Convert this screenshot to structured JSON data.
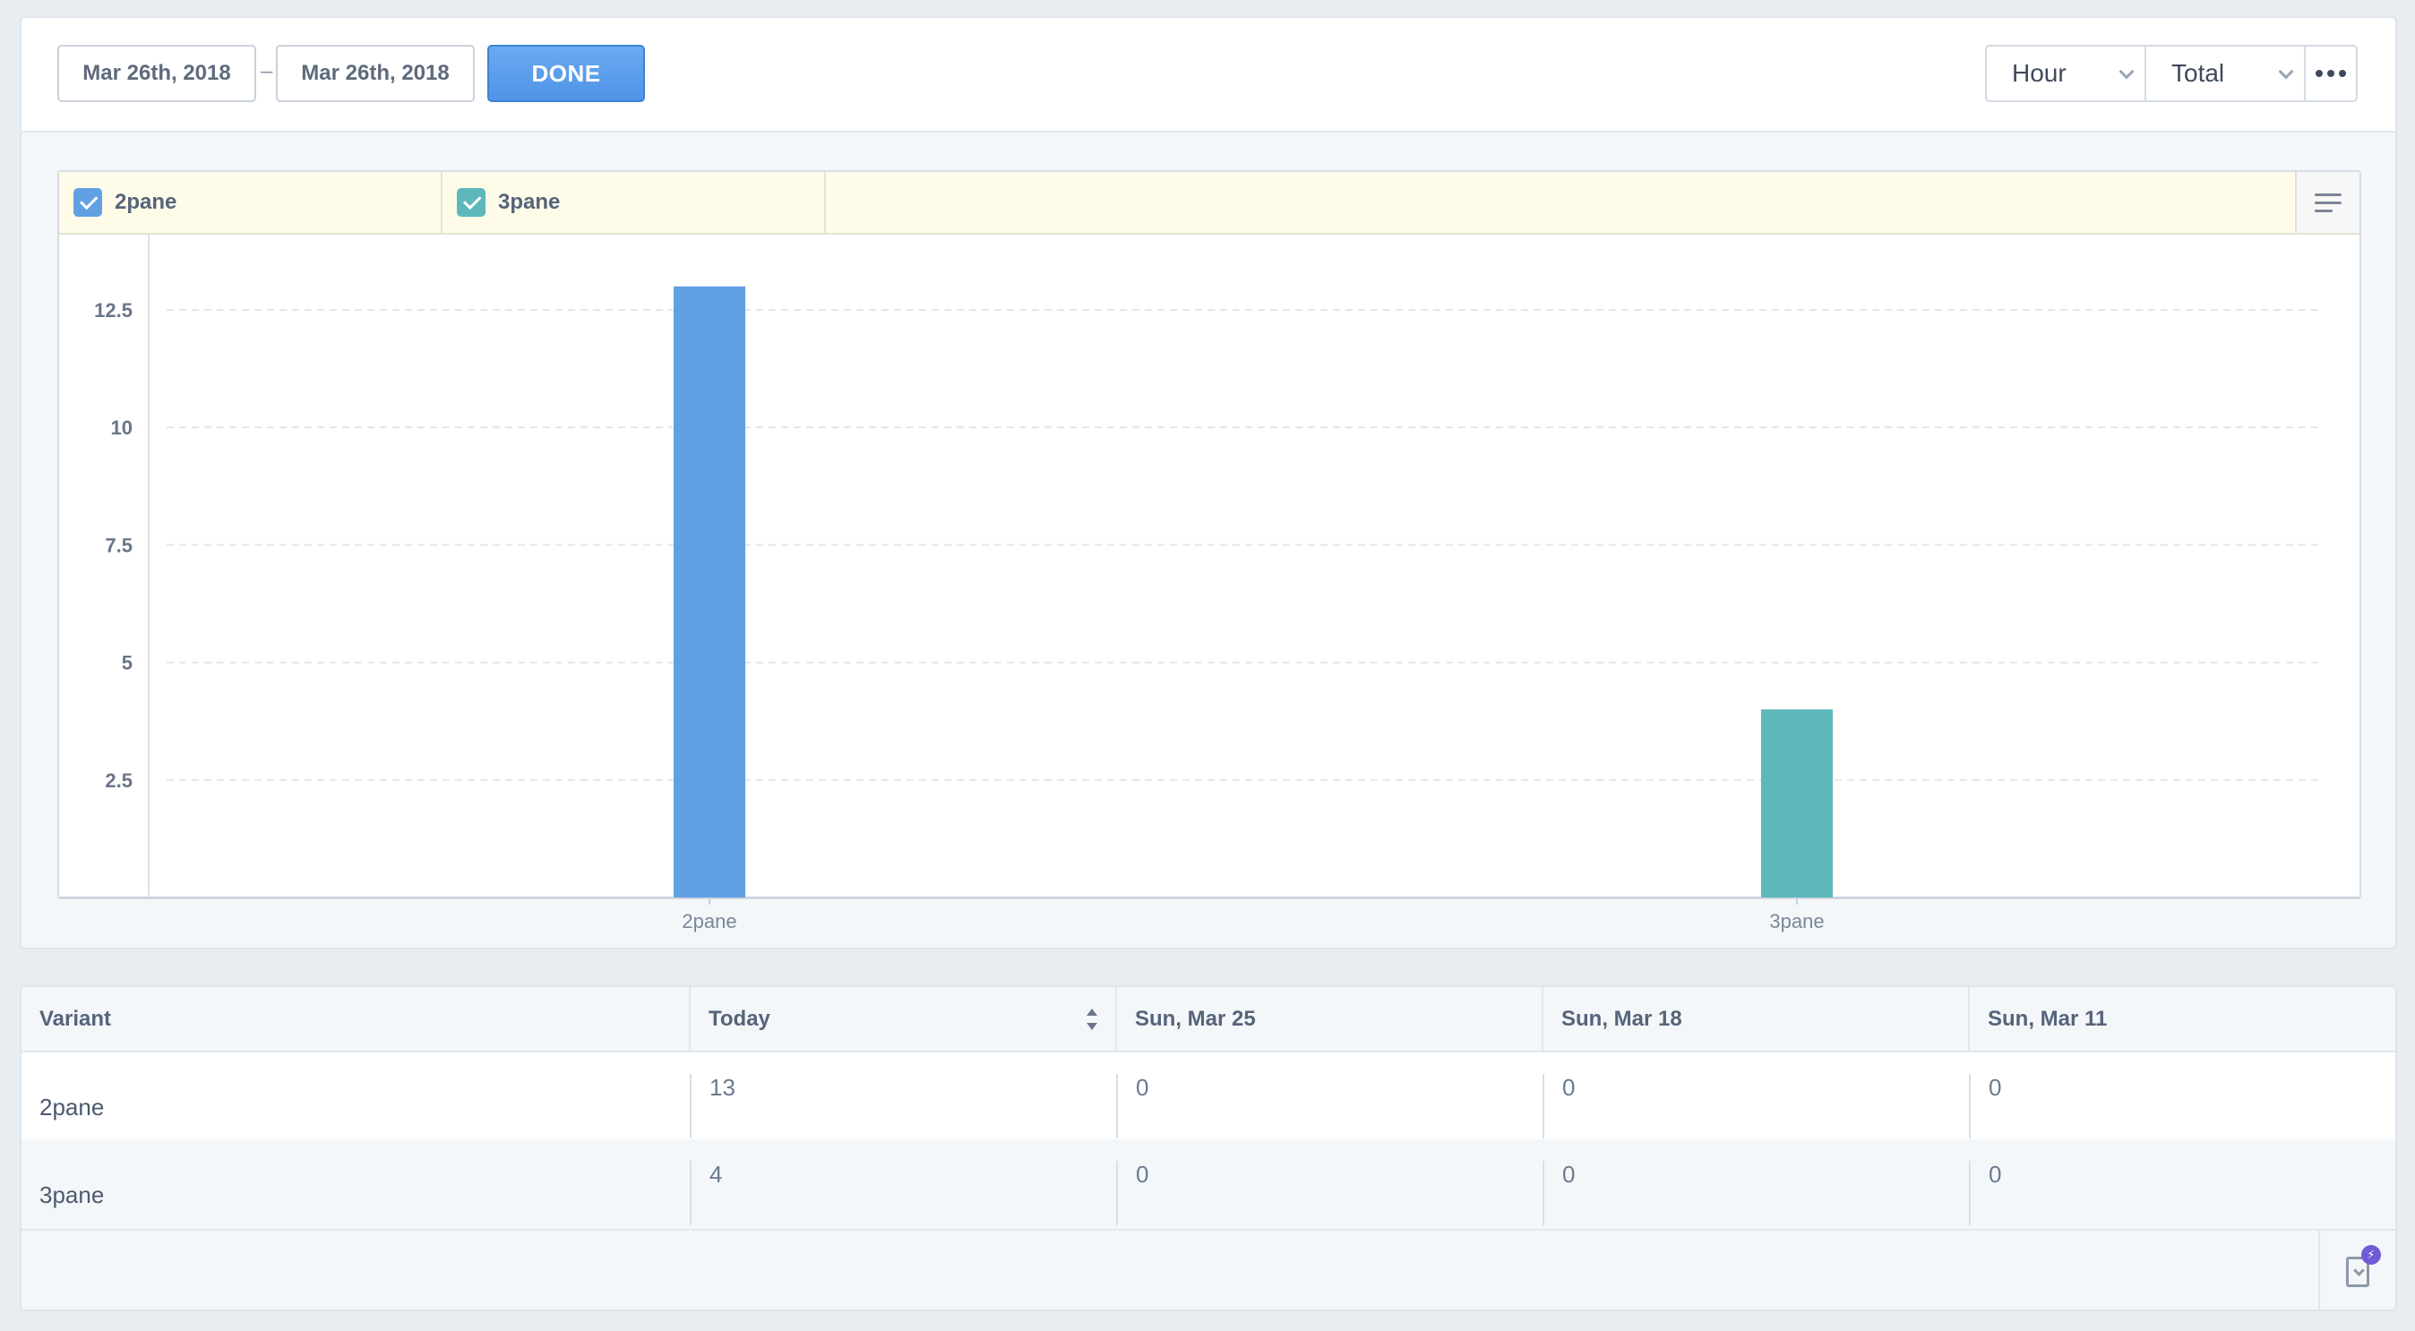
{
  "toolbar": {
    "date_start": "Mar 26th, 2018",
    "date_separator": "–",
    "date_end": "Mar 26th, 2018",
    "done_label": "DONE",
    "interval_select": "Hour",
    "measure_select": "Total"
  },
  "legend": {
    "items": [
      {
        "label": "2pane",
        "color": "#62a0e4",
        "checked": true
      },
      {
        "label": "3pane",
        "color": "#5db7bb",
        "checked": true
      }
    ]
  },
  "chart_data": {
    "type": "bar",
    "categories": [
      "2pane",
      "3pane"
    ],
    "values": [
      13,
      4
    ],
    "colors": [
      "#62a0e4",
      "#5db7bb"
    ],
    "ylim": [
      0,
      14.1
    ],
    "yticks": [
      2.5,
      5,
      7.5,
      10,
      12.5
    ],
    "grid": true,
    "xlabel": "",
    "ylabel": ""
  },
  "table": {
    "columns": [
      "Variant",
      "Today",
      "Sun, Mar 25",
      "Sun, Mar 18",
      "Sun, Mar 11"
    ],
    "rows": [
      {
        "variant": "2pane",
        "values": [
          "13",
          "0",
          "0",
          "0"
        ]
      },
      {
        "variant": "3pane",
        "values": [
          "4",
          "0",
          "0",
          "0"
        ]
      }
    ]
  },
  "footer": {
    "export_badge": "⚡"
  }
}
